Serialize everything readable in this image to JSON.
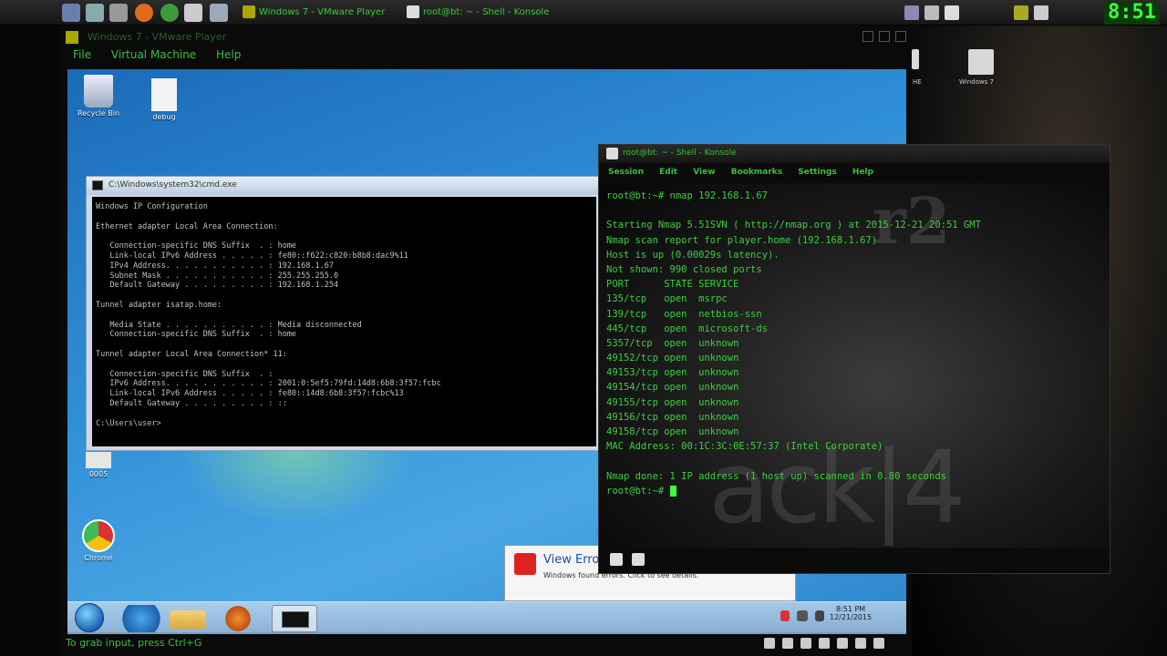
{
  "host_panel": {
    "tasks": [
      "Windows 7 - VMware Player",
      "root@bt: ~ - Shell - Konsole"
    ],
    "clock": "8:51"
  },
  "host_desktop": {
    "icons": [
      {
        "label": "HE"
      },
      {
        "label": "Windows 7"
      }
    ]
  },
  "vmware": {
    "title": "Windows 7 - VMware Player",
    "menu": [
      "File",
      "Virtual Machine",
      "Help"
    ],
    "status": "To grab input, press Ctrl+G"
  },
  "guest": {
    "desktop_icons": [
      {
        "label": "Recycle Bin"
      },
      {
        "label": "debug"
      },
      {
        "label": "0005"
      },
      {
        "label": "Chrome"
      }
    ],
    "cmd": {
      "title": "C:\\Windows\\system32\\cmd.exe",
      "lines": [
        "Windows IP Configuration",
        "",
        "Ethernet adapter Local Area Connection:",
        "",
        "   Connection-specific DNS Suffix  . : home",
        "   Link-local IPv6 Address . . . . . : fe80::f622:c820:b8b8:dac9%11",
        "   IPv4 Address. . . . . . . . . . . : 192.168.1.67",
        "   Subnet Mask . . . . . . . . . . . : 255.255.255.0",
        "   Default Gateway . . . . . . . . . : 192.168.1.254",
        "",
        "Tunnel adapter isatap.home:",
        "",
        "   Media State . . . . . . . . . . . : Media disconnected",
        "   Connection-specific DNS Suffix  . : home",
        "",
        "Tunnel adapter Local Area Connection* 11:",
        "",
        "   Connection-specific DNS Suffix  . :",
        "   IPv6 Address. . . . . . . . . . . : 2001:0:5ef5:79fd:14d8:6b8:3f57:fcbc",
        "   Link-local IPv6 Address . . . . . : fe80::14d8:6b8:3f57:fcbc%13",
        "   Default Gateway . . . . . . . . . : ::",
        "",
        "C:\\Users\\user>"
      ]
    },
    "balloon": {
      "heading": "View Errors",
      "text": "Windows found errors. Click to see details."
    },
    "taskbar_clock": {
      "time": "8:51 PM",
      "date": "12/21/2015"
    }
  },
  "konsole": {
    "title": "root@bt: ~ - Shell - Konsole",
    "menu": [
      "Session",
      "Edit",
      "View",
      "Bookmarks",
      "Settings",
      "Help"
    ],
    "watermark": "ack|4",
    "watermark2": "r2",
    "lines": [
      "root@bt:~# nmap 192.168.1.67",
      "",
      "Starting Nmap 5.51SVN ( http://nmap.org ) at 2015-12-21 20:51 GMT",
      "Nmap scan report for player.home (192.168.1.67)",
      "Host is up (0.00029s latency).",
      "Not shown: 990 closed ports",
      "PORT      STATE SERVICE",
      "135/tcp   open  msrpc",
      "139/tcp   open  netbios-ssn",
      "445/tcp   open  microsoft-ds",
      "5357/tcp  open  unknown",
      "49152/tcp open  unknown",
      "49153/tcp open  unknown",
      "49154/tcp open  unknown",
      "49155/tcp open  unknown",
      "49156/tcp open  unknown",
      "49158/tcp open  unknown",
      "MAC Address: 00:1C:3C:0E:57:37 (Intel Corporate)",
      "",
      "Nmap done: 1 IP address (1 host up) scanned in 0.80 seconds",
      "root@bt:~# "
    ]
  },
  "colors": {
    "terminal_green": "#3ccf3c",
    "clock_green": "#3cff3c",
    "win7_blue": "#2f8fd6"
  }
}
